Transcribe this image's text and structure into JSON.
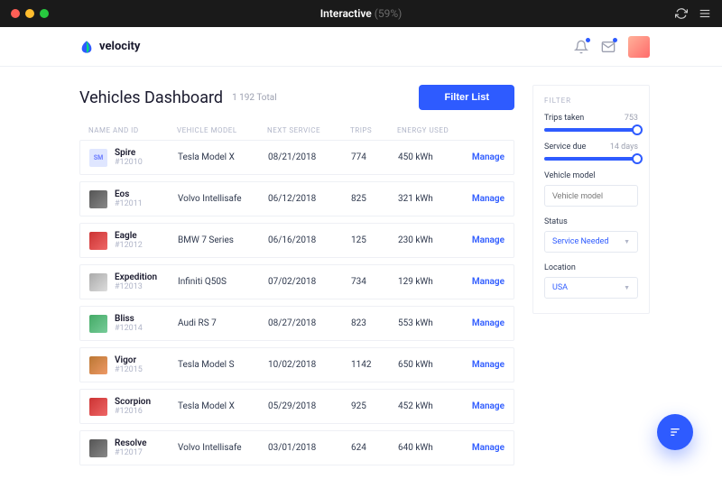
{
  "titlebar": {
    "title": "Interactive",
    "progress": "(59%)"
  },
  "brand": {
    "name": "velocity"
  },
  "page": {
    "heading": "Vehicles Dashboard",
    "total": "1 192 Total",
    "filter_button": "Filter List"
  },
  "columns": {
    "name": "NAME AND ID",
    "model": "VEHICLE MODEL",
    "service": "NEXT SERVICE",
    "trips": "TRIPS",
    "energy": "ENERGY USED"
  },
  "manage_label": "Manage",
  "vehicles": [
    {
      "badge": "SM",
      "name": "Spire",
      "id": "#12010",
      "model": "Tesla Model X",
      "service": "08/21/2018",
      "trips": "774",
      "energy": "450 kWh",
      "thumb": "sm"
    },
    {
      "name": "Eos",
      "id": "#12011",
      "model": "Volvo Intellisafe",
      "service": "06/12/2018",
      "trips": "825",
      "energy": "321 kWh",
      "thumb": "car1"
    },
    {
      "name": "Eagle",
      "id": "#12012",
      "model": "BMW 7 Series",
      "service": "06/16/2018",
      "trips": "125",
      "energy": "230 kWh",
      "thumb": "car2"
    },
    {
      "name": "Expedition",
      "id": "#12013",
      "model": "Infiniti Q50S",
      "service": "07/02/2018",
      "trips": "734",
      "energy": "129 kWh",
      "thumb": "car4"
    },
    {
      "name": "Bliss",
      "id": "#12014",
      "model": "Audi RS 7",
      "service": "08/27/2018",
      "trips": "823",
      "energy": "553 kWh",
      "thumb": "car3"
    },
    {
      "name": "Vigor",
      "id": "#12015",
      "model": "Tesla Model S",
      "service": "10/02/2018",
      "trips": "1142",
      "energy": "650 kWh",
      "thumb": "car5"
    },
    {
      "name": "Scorpion",
      "id": "#12016",
      "model": "Tesla Model X",
      "service": "05/29/2018",
      "trips": "925",
      "energy": "452 kWh",
      "thumb": "car2"
    },
    {
      "name": "Resolve",
      "id": "#12017",
      "model": "Volvo Intellisafe",
      "service": "03/01/2018",
      "trips": "624",
      "energy": "640 kWh",
      "thumb": "car1"
    }
  ],
  "filter": {
    "heading": "FILTER",
    "trips": {
      "label": "Trips taken",
      "value": "753"
    },
    "service": {
      "label": "Service due",
      "value": "14 days"
    },
    "model": {
      "label": "Vehicle model",
      "placeholder": "Vehicle model"
    },
    "status": {
      "label": "Status",
      "value": "Service Needed"
    },
    "location": {
      "label": "Location",
      "value": "USA"
    }
  }
}
